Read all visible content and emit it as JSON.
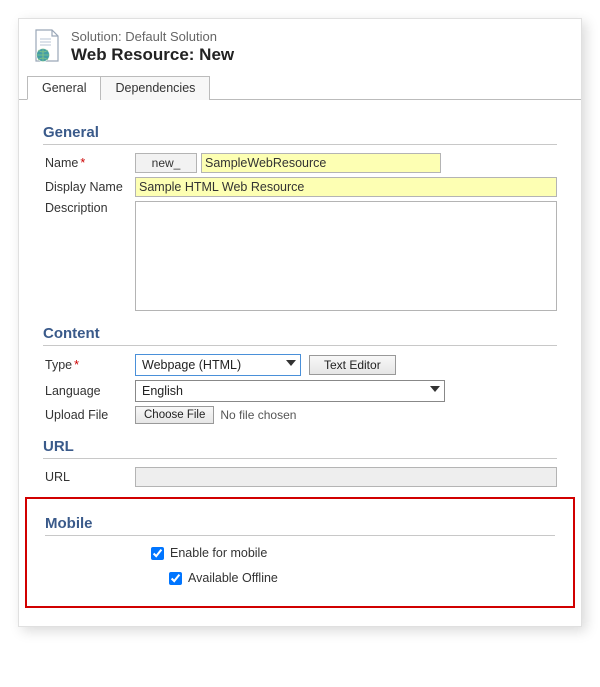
{
  "header": {
    "solution_label": "Solution: Default Solution",
    "entity_label": "Web Resource: New"
  },
  "tabs": {
    "general": "General",
    "dependencies": "Dependencies"
  },
  "sections": {
    "general": "General",
    "content": "Content",
    "url": "URL",
    "mobile": "Mobile"
  },
  "fields": {
    "name": {
      "label": "Name",
      "prefix": "new_",
      "value": "SampleWebResource"
    },
    "display_name": {
      "label": "Display Name",
      "value": "Sample HTML Web Resource"
    },
    "description": {
      "label": "Description",
      "value": ""
    },
    "type": {
      "label": "Type",
      "value": "Webpage (HTML)"
    },
    "language": {
      "label": "Language",
      "value": "English"
    },
    "upload": {
      "label": "Upload File",
      "button": "Choose File",
      "status": "No file chosen"
    },
    "url": {
      "label": "URL",
      "value": ""
    }
  },
  "buttons": {
    "text_editor": "Text Editor"
  },
  "mobile": {
    "enable": {
      "label": "Enable for mobile",
      "checked": true
    },
    "offline": {
      "label": "Available Offline",
      "checked": true
    }
  }
}
